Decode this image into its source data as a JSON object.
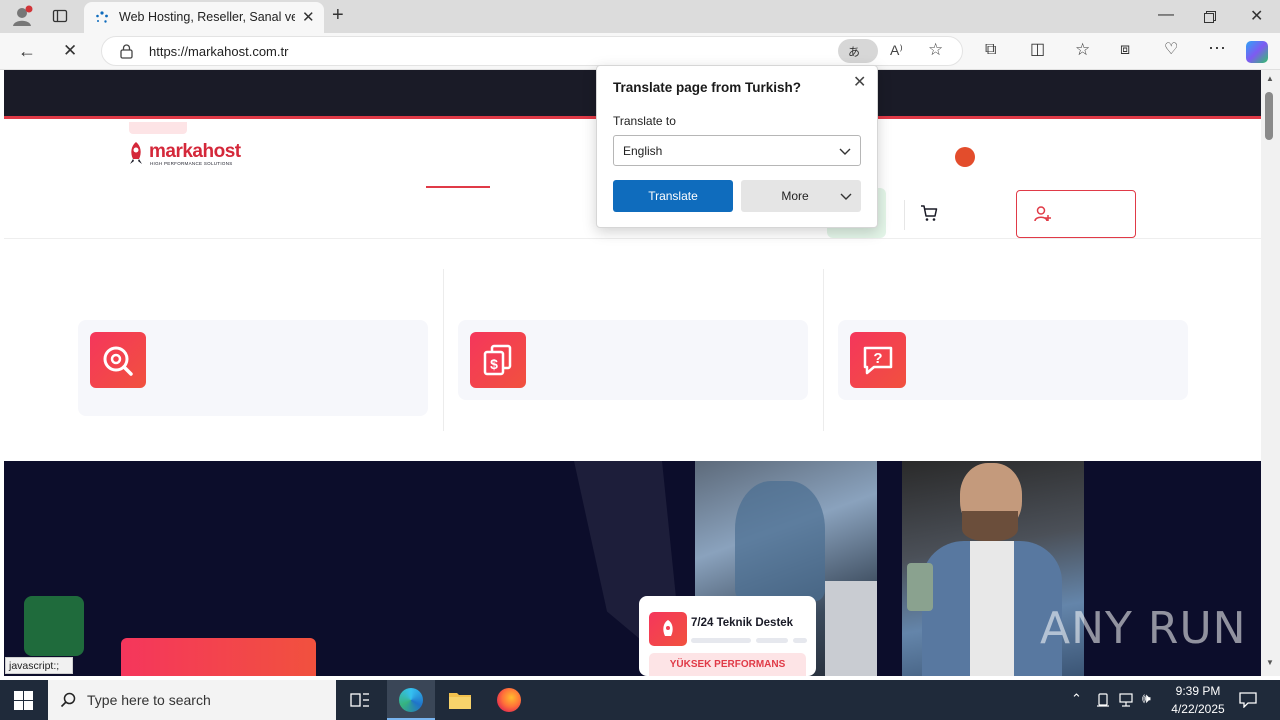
{
  "browser": {
    "tab_title": "Web Hosting, Reseller, Sanal ve F",
    "url": "https://markahost.com.tr",
    "status_text": "javascript:;"
  },
  "site": {
    "logo_name": "markahost",
    "logo_tagline": "HIGH PERFORMANCE SOLUTIONS",
    "hero_card_title": "7/24 Teknik Destek",
    "hero_card_badge": "YÜKSEK PERFORMANS"
  },
  "translate_popup": {
    "title": "Translate page from Turkish?",
    "translate_to_label": "Translate to",
    "language_value": "English",
    "translate_button": "Translate",
    "more_button": "More"
  },
  "watermark": "ANY RUN",
  "taskbar": {
    "search_placeholder": "Type here to search",
    "time": "9:39 PM",
    "date": "4/22/2025"
  },
  "colors": {
    "accent_red": "#e03a47",
    "translate_blue": "#0f6cbd",
    "hero_dark": "#0c0d2b"
  }
}
